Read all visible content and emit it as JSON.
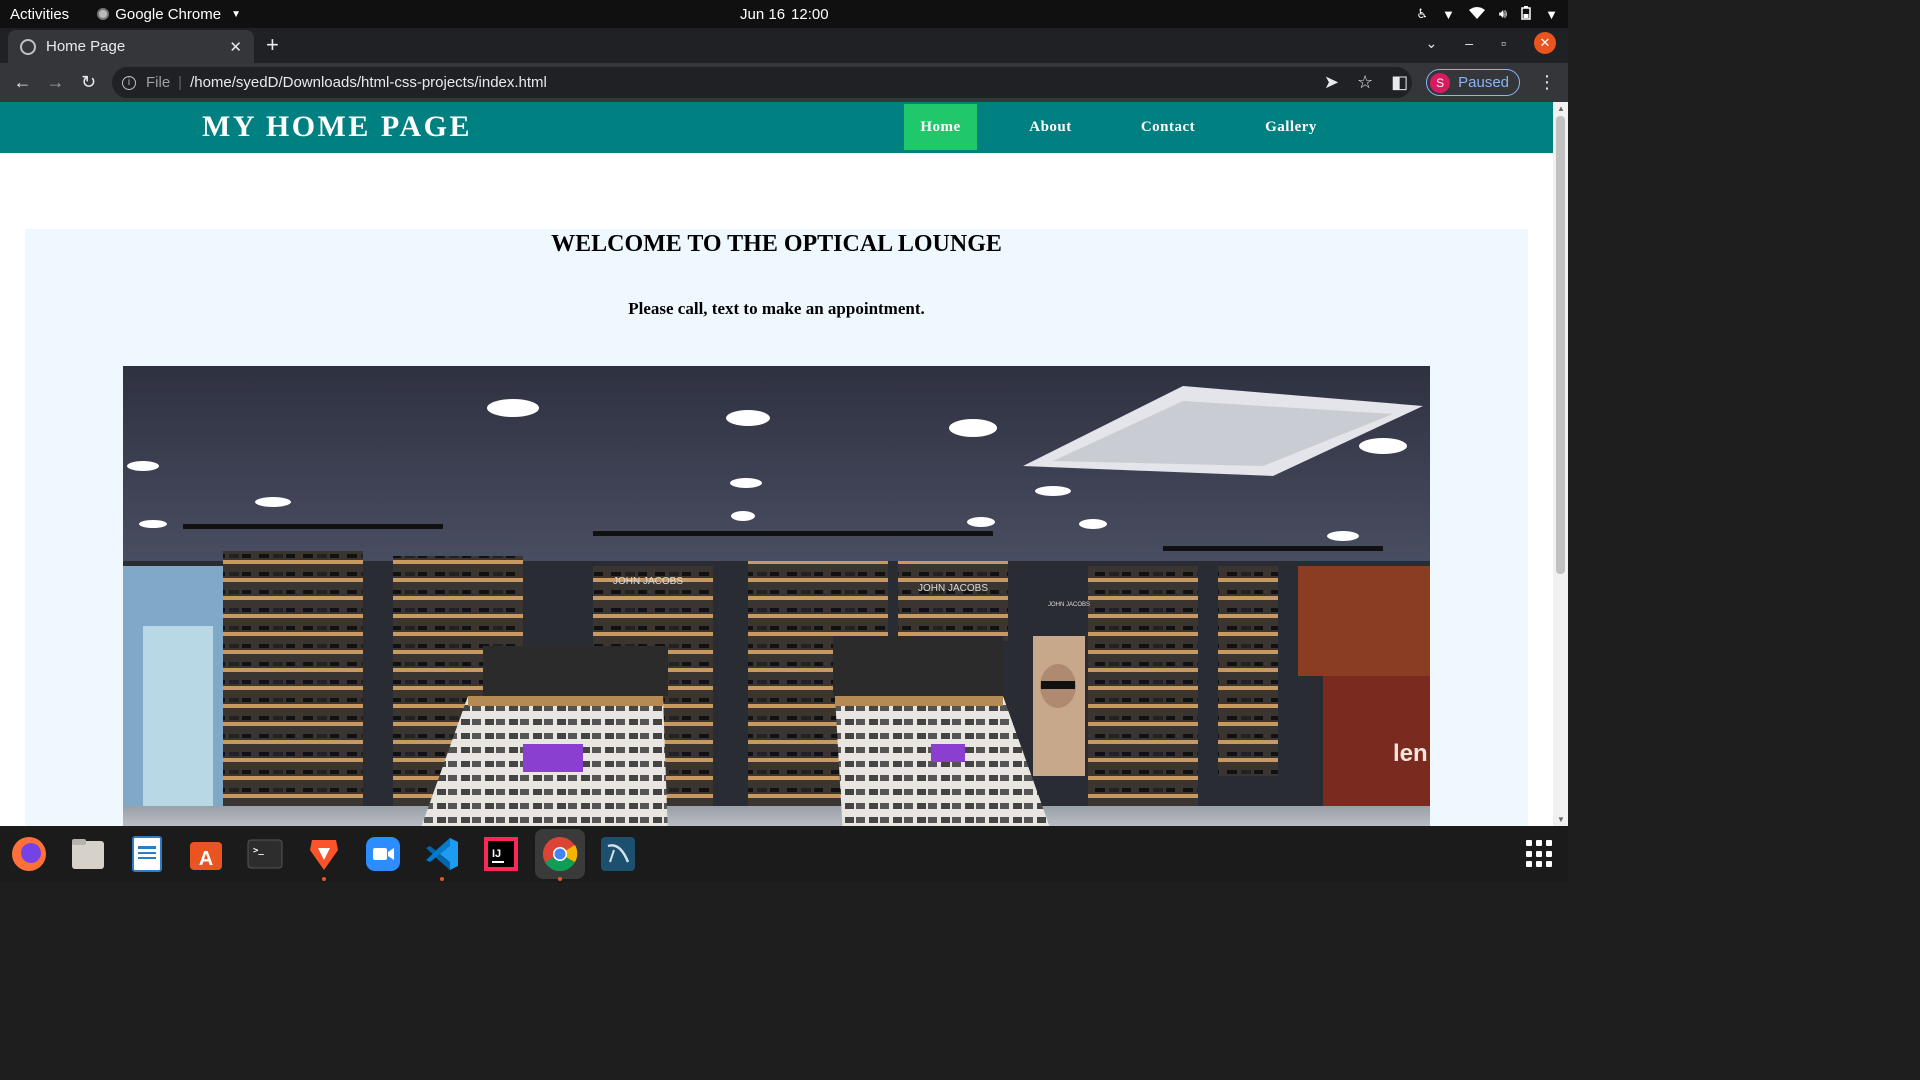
{
  "system_bar": {
    "activities": "Activities",
    "app_name": "Google Chrome",
    "date": "Jun 16",
    "time": "12:00"
  },
  "browser": {
    "tab_title": "Home Page",
    "address_scheme": "File",
    "address_url": "/home/syedD/Downloads/html-css-projects/index.html",
    "profile_initial": "S",
    "profile_status": "Paused"
  },
  "site": {
    "title": "MY HOME PAGE",
    "nav": [
      "Home",
      "About",
      "Contact",
      "Gallery"
    ],
    "active_nav": "Home",
    "accent_color": "#008080",
    "active_color": "#1ec86b",
    "heading": "WELCOME TO THE OPTICAL LOUNGE",
    "subheading": "Please call, text to make an appointment.",
    "image_alt": "Optical store interior with eyewear display shelves",
    "store_brand_signs": [
      "JOHN JACOBS",
      "JOHN JACOBS",
      "JOHN JACOBS",
      "len"
    ]
  },
  "dock": {
    "apps": [
      "firefox-icon",
      "files-icon",
      "writer-icon",
      "software-icon",
      "terminal-icon",
      "brave-icon",
      "zoom-icon",
      "vscode-icon",
      "intellij-icon",
      "chrome-icon",
      "mysql-workbench-icon"
    ]
  }
}
